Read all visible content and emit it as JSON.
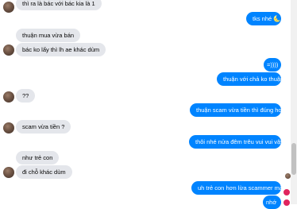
{
  "messages": {
    "m1": "thì ra là bác với bác kia là 1",
    "m2": "tks nhé",
    "m2_emoji": "🌜",
    "m3": "thuận mua vừa bán",
    "m4": "bác ko lấy thì lh ae khác dùm",
    "m5": "=))))",
    "m6": "thuận với chả ko thuận",
    "m7": "??",
    "m8": "thuận scam vừa tiền thì đúng hơn",
    "m9": "scam vừa tiền ?",
    "m10": "thôi nhé nửa đêm trêu vui vui vậy",
    "m11": "như trẻ con",
    "m12": "đi chỗ khác dùm",
    "m13": "uh trẻ con hơn lừa scammer mà",
    "m14": "nhớ"
  },
  "colors": {
    "incoming_bubble": "#e4e6eb",
    "outgoing_bubble": "#0084ff"
  }
}
